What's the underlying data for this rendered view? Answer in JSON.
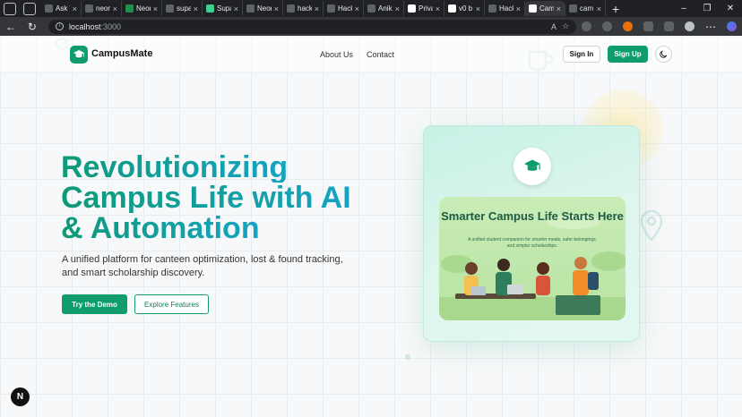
{
  "browser": {
    "tabs": [
      {
        "label": "Ask V"
      },
      {
        "label": "neon"
      },
      {
        "label": "Neon"
      },
      {
        "label": "supa"
      },
      {
        "label": "Supa"
      },
      {
        "label": "Neon"
      },
      {
        "label": "hack"
      },
      {
        "label": "Hack"
      },
      {
        "label": "Anik"
      },
      {
        "label": "Priva"
      },
      {
        "label": "v0 b"
      },
      {
        "label": "Hack"
      },
      {
        "label": "Cam"
      },
      {
        "label": "cam"
      }
    ],
    "url_host": "localhost",
    "url_port": ":3000"
  },
  "nav": {
    "brand": "CampusMate",
    "links": [
      "About Us",
      "Contact"
    ],
    "sign_in": "Sign In",
    "sign_up": "Sign Up"
  },
  "hero": {
    "title_lines": [
      "Revolutionizing",
      "Campus Life with AI",
      "& Automation"
    ],
    "subtitle": "A unified platform for canteen optimization, lost & found tracking, and smart scholarship discovery.",
    "primary_cta": "Try the Demo",
    "secondary_cta": "Explore Features"
  },
  "card": {
    "headline": "Smarter Campus Life Starts Here",
    "tagline": "A unified student companion for smarter meals, safer belongings, and simpler scholarships."
  },
  "badge": "N",
  "colors": {
    "accent": "#0f9d6e",
    "title_start": "#0e9a77",
    "title_end": "#16a3c4"
  }
}
